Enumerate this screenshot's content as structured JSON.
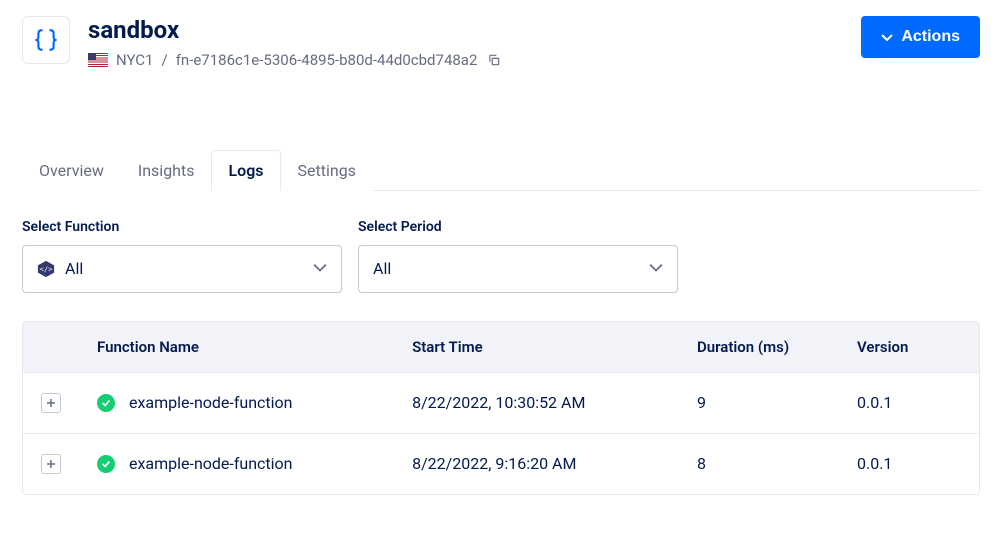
{
  "header": {
    "title": "sandbox",
    "region": "NYC1",
    "resource_id": "fn-e7186c1e-5306-4895-b80d-44d0cbd748a2",
    "actions_label": "Actions"
  },
  "tabs": [
    {
      "label": "Overview",
      "active": false
    },
    {
      "label": "Insights",
      "active": false
    },
    {
      "label": "Logs",
      "active": true
    },
    {
      "label": "Settings",
      "active": false
    }
  ],
  "filters": {
    "function": {
      "label": "Select Function",
      "value": "All"
    },
    "period": {
      "label": "Select Period",
      "value": "All"
    }
  },
  "table": {
    "columns": {
      "name": "Function Name",
      "start": "Start Time",
      "duration": "Duration (ms)",
      "version": "Version"
    },
    "rows": [
      {
        "status": "success",
        "name": "example-node-function",
        "start": "8/22/2022, 10:30:52 AM",
        "duration": "9",
        "version": "0.0.1"
      },
      {
        "status": "success",
        "name": "example-node-function",
        "start": "8/22/2022, 9:16:20 AM",
        "duration": "8",
        "version": "0.0.1"
      }
    ]
  }
}
